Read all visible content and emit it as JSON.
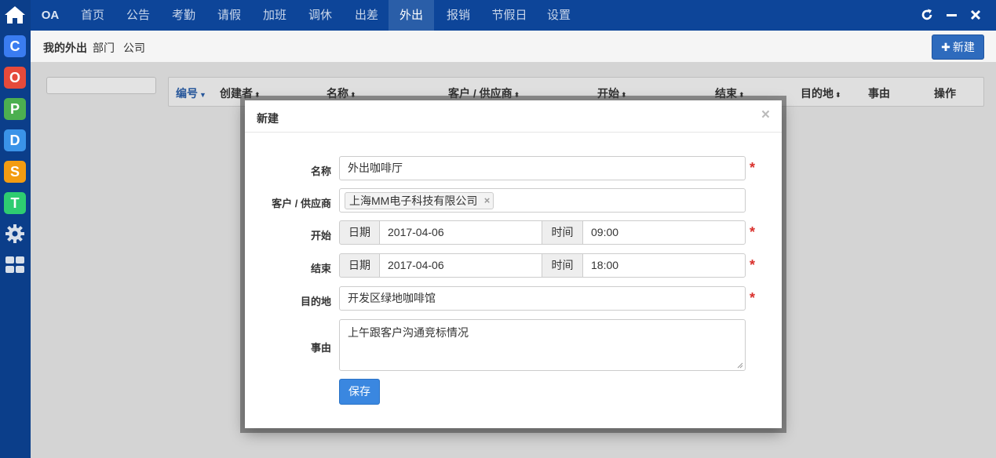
{
  "nav": {
    "items": [
      {
        "label": "OA"
      },
      {
        "label": "首页"
      },
      {
        "label": "公告"
      },
      {
        "label": "考勤"
      },
      {
        "label": "请假"
      },
      {
        "label": "加班"
      },
      {
        "label": "调休"
      },
      {
        "label": "出差"
      },
      {
        "label": "外出"
      },
      {
        "label": "报销"
      },
      {
        "label": "节假日"
      },
      {
        "label": "设置"
      }
    ],
    "active": "外出"
  },
  "rail": {
    "apps": [
      {
        "icon": "c-app-icon",
        "letter": "C",
        "color": "#3a7cf0"
      },
      {
        "icon": "o-app-icon",
        "letter": "O",
        "color": "#e64a3b"
      },
      {
        "icon": "p-app-icon",
        "letter": "P",
        "color": "#4caf50"
      },
      {
        "icon": "d-app-icon",
        "letter": "D",
        "color": "#3a93e8"
      },
      {
        "icon": "s-app-icon",
        "letter": "S",
        "color": "#f39c12"
      },
      {
        "icon": "t-app-icon",
        "letter": "T",
        "color": "#2ecc71"
      }
    ]
  },
  "subbar": {
    "tabs": [
      {
        "label": "我的外出"
      },
      {
        "label": "部门"
      },
      {
        "label": "公司"
      }
    ],
    "new_button": "新建"
  },
  "table": {
    "columns": [
      {
        "label": "编号"
      },
      {
        "label": "创建者"
      },
      {
        "label": "名称"
      },
      {
        "label": "客户 / 供应商"
      },
      {
        "label": "开始"
      },
      {
        "label": "结束"
      },
      {
        "label": "目的地"
      },
      {
        "label": "事由"
      },
      {
        "label": "操作"
      }
    ]
  },
  "modal": {
    "title": "新建",
    "close": "×",
    "fields": {
      "name": {
        "label": "名称",
        "value": "外出咖啡厅"
      },
      "client": {
        "label": "客户 / 供应商",
        "tag": "上海MM电子科技有限公司",
        "tag_remove": "×"
      },
      "start": {
        "label": "开始",
        "date_addon": "日期",
        "date": "2017-04-06",
        "time_addon": "时间",
        "time": "09:00"
      },
      "end": {
        "label": "结束",
        "date_addon": "日期",
        "date": "2017-04-06",
        "time_addon": "时间",
        "time": "18:00"
      },
      "destination": {
        "label": "目的地",
        "value": "开发区绿地咖啡馆"
      },
      "reason": {
        "label": "事由",
        "value": "上午跟客户沟通竞标情况"
      }
    },
    "required_mark": "*",
    "save": "保存"
  },
  "colors": {
    "nav_bg": "#0d4599",
    "rail_bg": "#0b3e8a",
    "accent": "#3a87e0",
    "required": "#d9302c"
  }
}
